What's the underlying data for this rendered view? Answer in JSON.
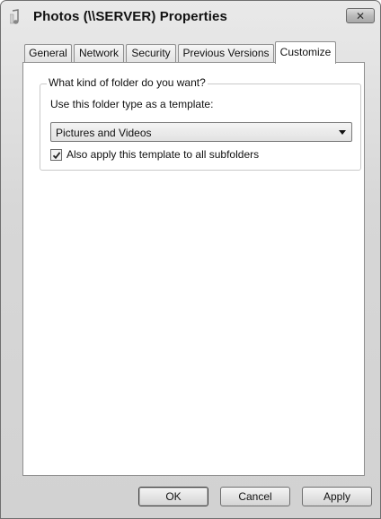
{
  "window": {
    "title": "Photos (\\\\SERVER) Properties",
    "close_symbol": "✕"
  },
  "tabs": [
    {
      "label": "General",
      "active": false
    },
    {
      "label": "Network",
      "active": false
    },
    {
      "label": "Security",
      "active": false
    },
    {
      "label": "Previous Versions",
      "active": false
    },
    {
      "label": "Customize",
      "active": true
    }
  ],
  "customize": {
    "group_title": "What kind of folder do you want?",
    "template_label": "Use this folder type as a template:",
    "folder_type": {
      "selected": "Pictures and Videos"
    },
    "apply_subfolders": {
      "label": "Also apply this template to all subfolders",
      "checked": true
    }
  },
  "buttons": {
    "ok": "OK",
    "cancel": "Cancel",
    "apply": "Apply"
  },
  "icons": {
    "title_icon": "folder-music-icon",
    "close": "close-icon",
    "dropdown": "chevron-down-icon",
    "check": "checkmark-icon"
  }
}
